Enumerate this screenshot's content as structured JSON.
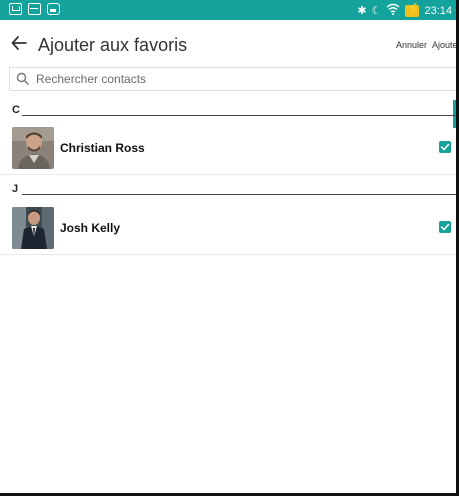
{
  "status_bar": {
    "time": "23:14",
    "left_icons": [
      "message-icon",
      "mail-icon",
      "photo-icon"
    ],
    "right_icons": [
      "bluetooth-icon",
      "moon-icon",
      "wifi-icon",
      "battery-charging-icon"
    ],
    "accent": "#14a39c"
  },
  "app_bar": {
    "title": "Ajouter aux favoris",
    "cancel_label": "Annuler",
    "add_label": "Ajouter"
  },
  "search": {
    "placeholder": "Rechercher contacts",
    "value": ""
  },
  "sections": [
    {
      "letter": "C",
      "contacts": [
        {
          "name": "Christian Ross",
          "checked": true
        }
      ]
    },
    {
      "letter": "J",
      "contacts": [
        {
          "name": "Josh Kelly",
          "checked": true
        }
      ]
    }
  ],
  "colors": {
    "accent": "#14a39c",
    "text_primary": "#111111",
    "divider": "#ebebeb"
  }
}
